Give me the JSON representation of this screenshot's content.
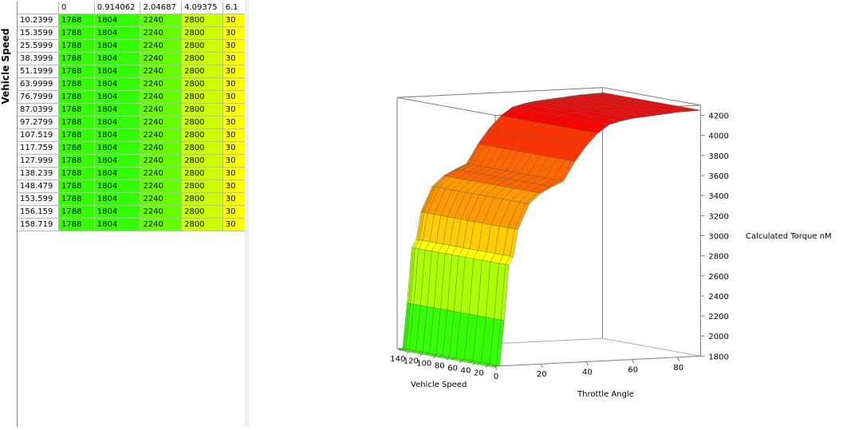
{
  "table": {
    "row_axis_label": "Vehicle Speed",
    "column_headers": [
      "0",
      "0.914062",
      "2.04687",
      "4.09375",
      "6.1"
    ],
    "row_headers": [
      "10.2399",
      "15.3599",
      "25.5999",
      "38.3999",
      "51.1999",
      "63.9999",
      "76.7999",
      "87.0399",
      "97.2799",
      "107.519",
      "117.759",
      "127.999",
      "138.239",
      "148.479",
      "153.599",
      "156.159",
      "158.719"
    ],
    "row_values": [
      "1788",
      "1804",
      "2240",
      "2800",
      "30"
    ],
    "cell_colors": [
      "#33ff00",
      "#33ff00",
      "#66ff00",
      "#ccff00",
      "#ffff00"
    ]
  },
  "chart_data": {
    "type": "surface3d",
    "x": [
      10.2399,
      15.3599,
      25.5999,
      38.3999,
      51.1999,
      63.9999,
      76.7999,
      87.0399,
      97.2799,
      107.519,
      117.759,
      127.999,
      138.239,
      148.479,
      153.599,
      156.159,
      158.719
    ],
    "y": [
      0,
      2,
      4,
      6,
      8,
      10,
      15,
      20,
      25,
      30,
      35,
      40,
      45,
      50,
      55,
      60,
      65,
      70,
      75,
      80,
      85,
      90
    ],
    "z_profile": [
      1788,
      1800,
      2250,
      2800,
      2880,
      3150,
      3400,
      3500,
      3560,
      3610,
      3800,
      3950,
      4070,
      4150,
      4180,
      4200,
      4210,
      4220,
      4230,
      4240,
      4245,
      4250
    ],
    "z_band_colors": [
      "#33ff00",
      "#66ff00",
      "#aaff00",
      "#ffff00",
      "#ffcc00",
      "#ff9900",
      "#ff6600",
      "#ff3300",
      "#ff0000"
    ],
    "xlabel": "Vehicle Speed",
    "ylabel": "Throttle Angle",
    "zlabel": "Calculated Torque nM",
    "xticks": [
      20,
      40,
      60,
      80,
      100,
      120,
      140
    ],
    "yticks": [
      0,
      20,
      40,
      60,
      80
    ],
    "zticks": [
      1800,
      2000,
      2200,
      2400,
      2600,
      2800,
      3000,
      3200,
      3400,
      3600,
      3800,
      4000,
      4200
    ],
    "xlim": [
      10,
      160
    ],
    "ylim": [
      0,
      90
    ],
    "zlim": [
      1800,
      4300
    ]
  }
}
